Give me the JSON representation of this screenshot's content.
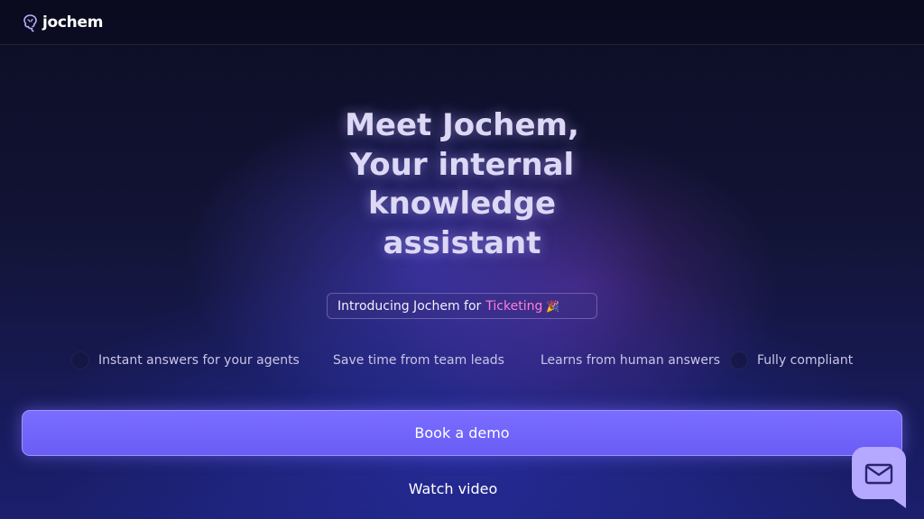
{
  "header": {
    "logo_text": "jochem"
  },
  "hero": {
    "title_lines": [
      "Meet Jochem,",
      "Your internal",
      "knowledge",
      "assistant"
    ]
  },
  "badge": {
    "prefix": "Introducing Jochem for",
    "accent": "Ticketing",
    "emoji": "🎉"
  },
  "features": [
    {
      "label": "Instant answers for your agents"
    },
    {
      "label": "Save time from team leads"
    },
    {
      "label": "Learns from human answers"
    },
    {
      "label": "Fully compliant"
    }
  ],
  "cta": {
    "primary_label": "Book a demo",
    "secondary_label": "Watch video"
  },
  "icons": {
    "logo": "brain-icon",
    "chat": "envelope-icon"
  },
  "colors": {
    "accent": "#7a6dff",
    "highlight": "#ff7fd8",
    "chat_bubble": "#b4a8ff"
  }
}
